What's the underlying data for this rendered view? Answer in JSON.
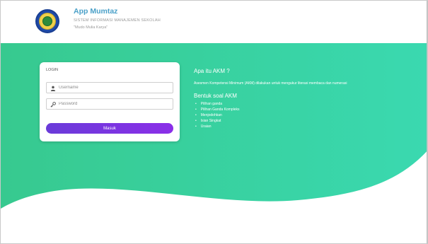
{
  "header": {
    "app_title": "App Mumtaz",
    "app_subtitle": "SISTEM INFORMASI MANAJEMEN SEKOLAH",
    "app_motto": "\"Mudo Mulia Karya\""
  },
  "login": {
    "label": "LOGIN",
    "username_placeholder": "Username",
    "password_placeholder": "Password",
    "submit_label": "Masuk"
  },
  "info": {
    "title": "Apa itu AKM ?",
    "description": "Asesmen Kompetensi Minimum (AKM) dilakukan untuk mengukur literasi membaca dan numerasi",
    "subtitle": "Bentuk soal AKM",
    "items": [
      "Pilihan ganda",
      "Pilihan Ganda Kompleks",
      "Menjodohkan",
      "Isian Singkat",
      "Uraian"
    ]
  },
  "colors": {
    "brand_green": "#3bd6a6",
    "button_purple": "#7a35e0",
    "title_blue": "#4aa0c8"
  },
  "icons": {
    "username": "user-icon",
    "password": "key-icon",
    "logo": "school-emblem-icon"
  }
}
